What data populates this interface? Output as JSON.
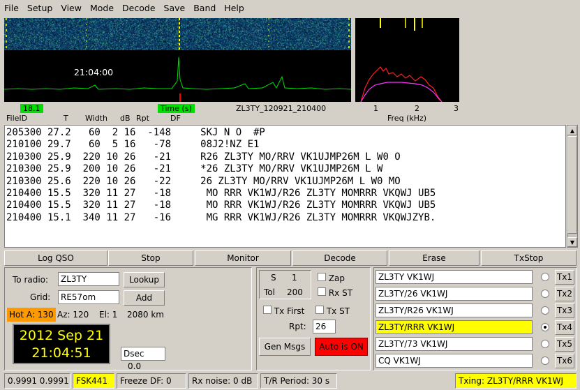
{
  "menu": [
    "File",
    "Setup",
    "View",
    "Mode",
    "Decode",
    "Save",
    "Band",
    "Help"
  ],
  "waterfall": {
    "time_overlay": "21:04:00",
    "left_badge": "18.1",
    "time_badge": "Time (s)",
    "filename": "ZL3TY_120921_210400",
    "freq_ticks": [
      "1",
      "2",
      "3"
    ],
    "freq_label": "Freq (kHz)"
  },
  "columns": {
    "fileid": "FileID",
    "t": "T",
    "width": "Width",
    "db": "dB",
    "rpt": "Rpt",
    "df": "DF"
  },
  "decodes": [
    "205300 27.2   60  2 16  -148     SKJ N O  #P",
    "210100 29.7   60  5 16   -78     08J2!NZ E1",
    "210300 25.9  220 10 26   -21     R26 ZL3TY MO/RRV VK1UJMP26M L W0 O",
    "210300 25.9  200 10 26   -21     *26 ZL3TY MO/RRV VK1UJMP26M L W",
    "210300 25.6  220 10 26   -22     26 ZL3TY MO/RRV VK1UJMP26M L W0 MO",
    "210400 15.5  320 11 27   -18      MO RRR VK1WJ/R26 ZL3TY MOMRRR VKQWJ UB5",
    "210400 15.5  320 11 27   -18      MO RRR VK1WJ/R26 ZL3TY MOMRRR VKQWJ UB5",
    "210400 15.1  340 11 27   -16      MG RRR VK1WJ/R26 ZL3TY MOMRRR VKQWJZYB."
  ],
  "buttons": {
    "log_qso": "Log QSO",
    "stop": "Stop",
    "monitor": "Monitor",
    "decode": "Decode",
    "erase": "Erase",
    "txstop": "TxStop"
  },
  "station": {
    "to_radio_label": "To radio:",
    "to_radio": "ZL3TY",
    "lookup": "Lookup",
    "grid_label": "Grid:",
    "grid": "RE57om",
    "add": "Add",
    "hot": "Hot A: 130",
    "az": "Az: 120",
    "el": "El: 1",
    "dist": "2080 km",
    "date": "2012 Sep 21",
    "time": "21:04:51",
    "dsec_label": "Dsec",
    "dsec": "0.0"
  },
  "controls": {
    "s_label": "S",
    "s_value": "1",
    "tol_label": "Tol",
    "tol_value": "200",
    "zap": "Zap",
    "rx_st": "Rx ST",
    "tx_first": "Tx First",
    "tx_st": "Tx ST",
    "rpt_label": "Rpt:",
    "rpt_value": "26",
    "gen_msgs": "Gen Msgs",
    "auto": "Auto is  ON"
  },
  "tx_messages": [
    {
      "text": "ZL3TY VK1WJ",
      "button": "Tx1",
      "selected": false
    },
    {
      "text": "ZL3TY/26 VK1WJ",
      "button": "Tx2",
      "selected": false
    },
    {
      "text": "ZL3TY/R26 VK1WJ",
      "button": "Tx3",
      "selected": false
    },
    {
      "text": "ZL3TY/RRR VK1WJ",
      "button": "Tx4",
      "selected": true
    },
    {
      "text": "ZL3TY/73  VK1WJ",
      "button": "Tx5",
      "selected": false
    },
    {
      "text": "CQ VK1WJ",
      "button": "Tx6",
      "selected": false
    }
  ],
  "status": {
    "levels": "0.9991 0.9991",
    "mode": "FSK441",
    "freeze": "Freeze DF:   0",
    "rx_noise": "Rx noise:  0 dB",
    "tr_period": "T/R Period: 30 s",
    "txing": "Txing:  ZL3TY/RRR VK1WJ"
  },
  "colors": {
    "highlight": "#ffff00",
    "green": "#00e000",
    "red": "#ff0000",
    "orange": "#ff9900",
    "wf_blue": "#0a3760"
  }
}
